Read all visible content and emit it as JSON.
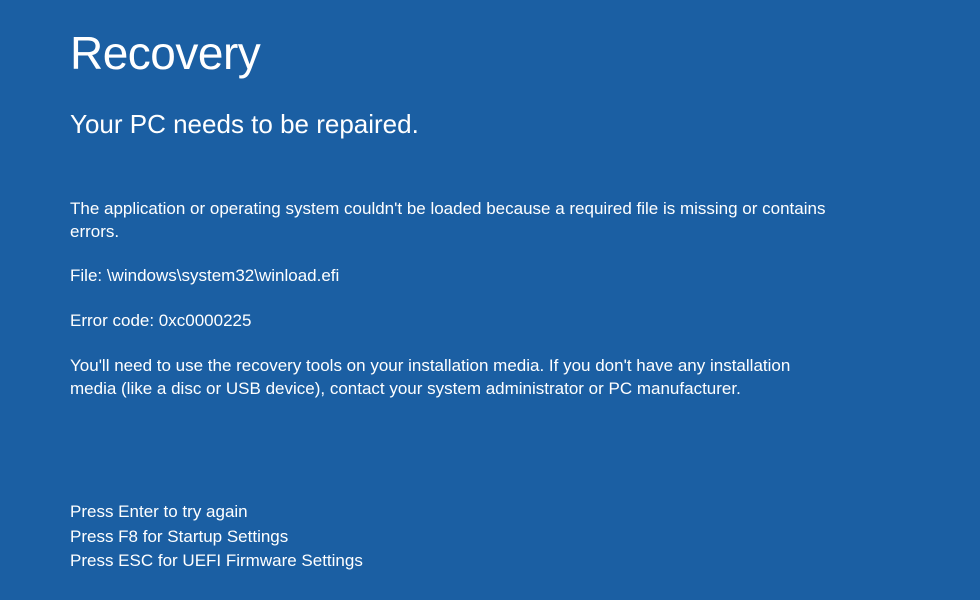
{
  "screen": {
    "title": "Recovery",
    "subtitle": "Your PC needs to be repaired.",
    "body": {
      "cause": "The application or operating system couldn't be loaded because a required file is missing or contains errors.",
      "file": "File: \\windows\\system32\\winload.efi",
      "error_code": "Error code: 0xc0000225",
      "instructions": "You'll need to use the recovery tools on your installation media. If you don't have any installation media (like a disc or USB device), contact your system administrator or PC manufacturer."
    },
    "options": {
      "enter": "Press Enter to try again",
      "f8": "Press F8 for Startup Settings",
      "esc": "Press ESC for UEFI Firmware Settings"
    }
  },
  "colors": {
    "background": "#1b5fa3",
    "text": "#ffffff"
  }
}
